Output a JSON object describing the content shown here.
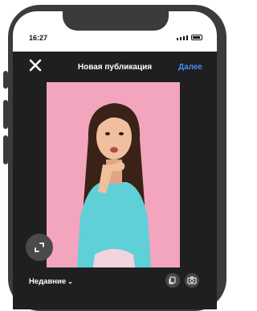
{
  "status": {
    "time": "16:27"
  },
  "header": {
    "title": "Новая публикация",
    "next_label": "Далее"
  },
  "gallery": {
    "source_label": "Недавние"
  },
  "icons": {
    "close": "close-icon",
    "expand": "expand-icon",
    "multi_select": "multi-select-icon",
    "camera": "camera-icon",
    "chevron": "chevron-down-icon"
  },
  "colors": {
    "accent": "#3e8ef7",
    "photo_bg": "#f2a5bd",
    "dress": "#5fd0d8"
  }
}
